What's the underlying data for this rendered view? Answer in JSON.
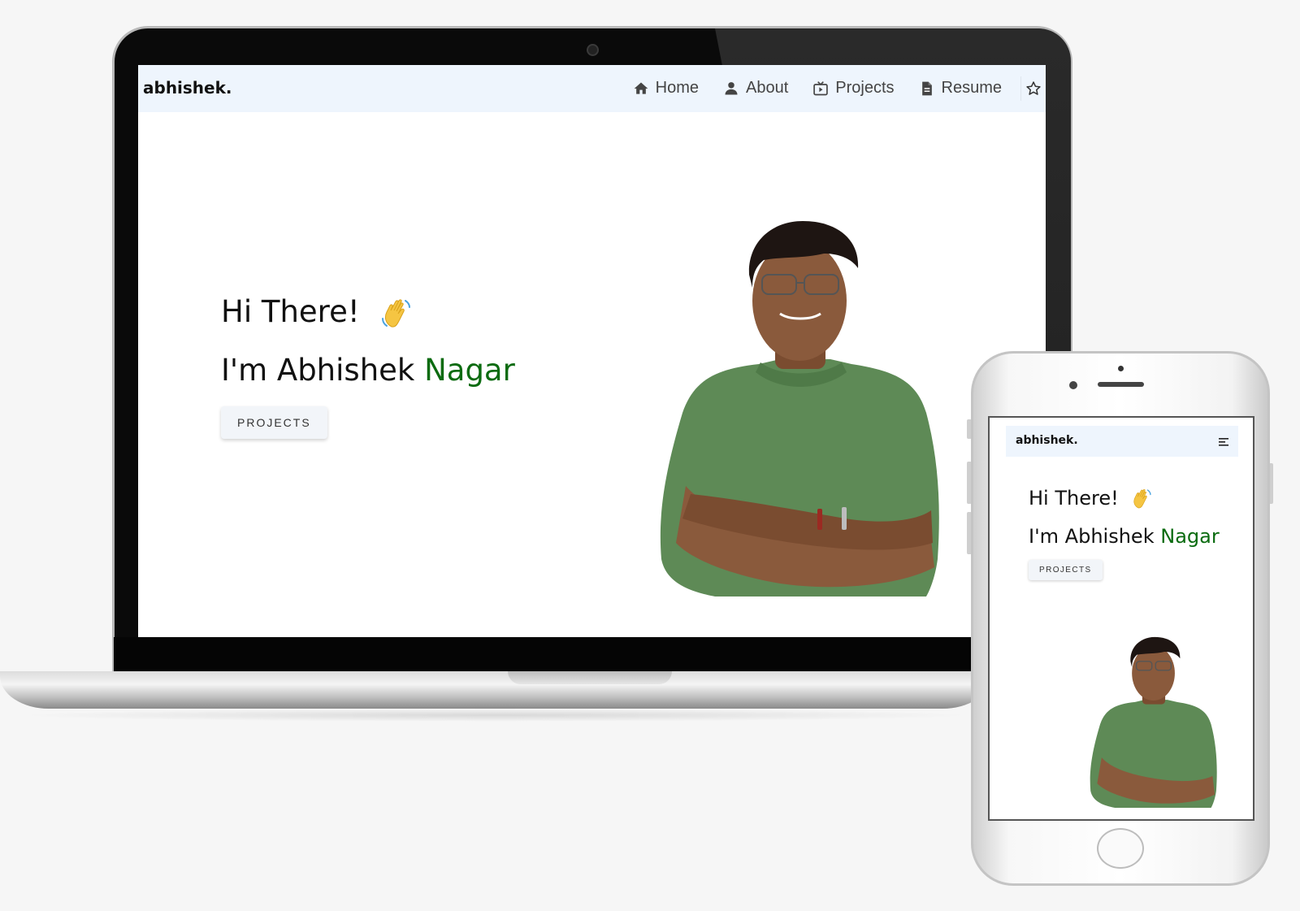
{
  "laptop": {
    "brand": "abhishek.",
    "nav": [
      {
        "label": "Home",
        "icon": "home-icon"
      },
      {
        "label": "About",
        "icon": "user-icon"
      },
      {
        "label": "Projects",
        "icon": "projects-icon"
      },
      {
        "label": "Resume",
        "icon": "document-icon"
      }
    ],
    "star_icon": "star-icon",
    "hero": {
      "greeting": "Hi There!",
      "intro_prefix": "I'm Abhishek ",
      "intro_highlight": "Nagar",
      "button_label": "PROJECTS"
    }
  },
  "phone": {
    "brand": "abhishek.",
    "menu_icon": "menu-icon",
    "hero": {
      "greeting": "Hi There!",
      "intro_prefix": "I'm Abhishek ",
      "intro_highlight": "Nagar",
      "button_label": "PROJECTS"
    }
  },
  "colors": {
    "accent_green": "#0b6b10",
    "nav_bg": "#eef5fd",
    "shirt_green": "#5e8a56"
  }
}
